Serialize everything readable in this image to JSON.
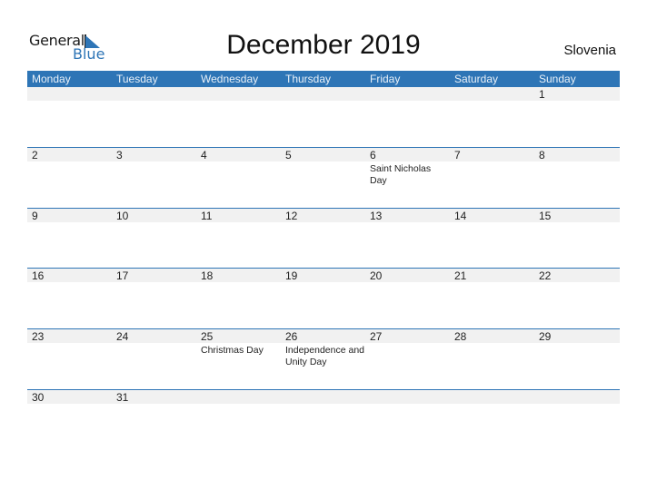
{
  "logo": {
    "general": "General",
    "blue": "Blue"
  },
  "title": "December 2019",
  "country": "Slovenia",
  "days": [
    "Monday",
    "Tuesday",
    "Wednesday",
    "Thursday",
    "Friday",
    "Saturday",
    "Sunday"
  ],
  "weeks": [
    [
      {
        "d": ""
      },
      {
        "d": ""
      },
      {
        "d": ""
      },
      {
        "d": ""
      },
      {
        "d": ""
      },
      {
        "d": ""
      },
      {
        "d": "1"
      }
    ],
    [
      {
        "d": "2"
      },
      {
        "d": "3"
      },
      {
        "d": "4"
      },
      {
        "d": "5"
      },
      {
        "d": "6",
        "ev": "Saint Nicholas Day"
      },
      {
        "d": "7"
      },
      {
        "d": "8"
      }
    ],
    [
      {
        "d": "9"
      },
      {
        "d": "10"
      },
      {
        "d": "11"
      },
      {
        "d": "12"
      },
      {
        "d": "13"
      },
      {
        "d": "14"
      },
      {
        "d": "15"
      }
    ],
    [
      {
        "d": "16"
      },
      {
        "d": "17"
      },
      {
        "d": "18"
      },
      {
        "d": "19"
      },
      {
        "d": "20"
      },
      {
        "d": "21"
      },
      {
        "d": "22"
      }
    ],
    [
      {
        "d": "23"
      },
      {
        "d": "24"
      },
      {
        "d": "25",
        "ev": "Christmas Day"
      },
      {
        "d": "26",
        "ev": "Independence and Unity Day"
      },
      {
        "d": "27"
      },
      {
        "d": "28"
      },
      {
        "d": "29"
      }
    ],
    [
      {
        "d": "30"
      },
      {
        "d": "31"
      },
      {
        "d": ""
      },
      {
        "d": ""
      },
      {
        "d": ""
      },
      {
        "d": ""
      },
      {
        "d": ""
      }
    ]
  ]
}
